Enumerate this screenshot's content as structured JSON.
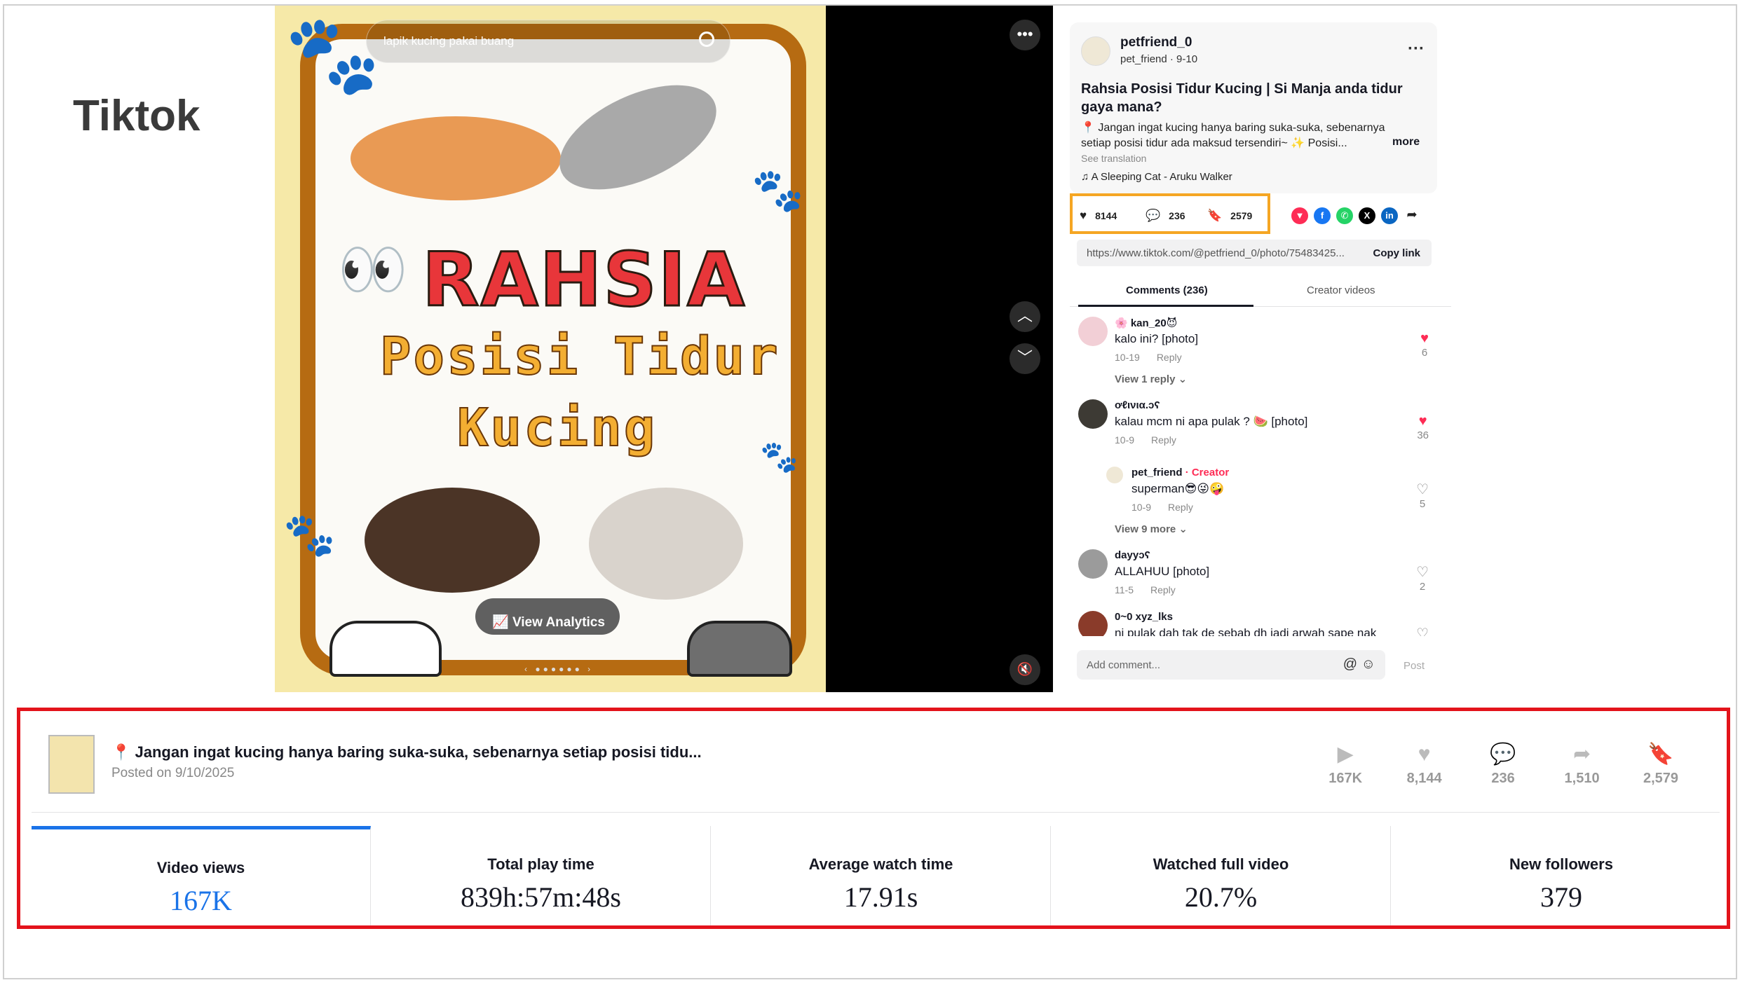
{
  "slide": {
    "title": "Tiktok"
  },
  "photo": {
    "search_text": "lapik kucing pakai buang",
    "overlay_title": "RAHSIA",
    "overlay_line2": "Posisi Tidur",
    "overlay_line3": "Kucing",
    "view_analytics": "View Analytics"
  },
  "post": {
    "author": "petfriend_0",
    "author_sub": "pet_friend · 9-10",
    "title": "Rahsia Posisi Tidur Kucing | Si Manja anda tidur gaya mana?",
    "description": "📍 Jangan ingat kucing hanya baring suka-suka, sebenarnya setiap posisi tidur ada maksud tersendiri~ ✨ Posisi...",
    "more": "more",
    "see_translation": "See translation",
    "music": "♫  A Sleeping Cat - Aruku Walker",
    "likes": "8144",
    "comments": "236",
    "saves": "2579",
    "link": "https://www.tiktok.com/@petfriend_0/photo/75483425...",
    "copy_link": "Copy link"
  },
  "tabs": [
    {
      "label": "Comments (236)"
    },
    {
      "label": "Creator videos"
    }
  ],
  "comments": [
    {
      "user": "🌸 kan_20😈",
      "text": "kalo ini? [photo]",
      "date": "10-19",
      "reply": "Reply",
      "likes": "6",
      "liked": true,
      "view_more": "View 1 reply ⌄"
    },
    {
      "user": "ơℓινια.ɔʕ",
      "text": "kalau mcm ni apa pulak ? 🍉 [photo]",
      "date": "10-9",
      "reply": "Reply",
      "likes": "36",
      "liked": true
    },
    {
      "user": "pet_friend",
      "creator": "· Creator",
      "text": "superman😎😜🤪",
      "date": "10-9",
      "reply": "Reply",
      "likes": "5",
      "liked": false,
      "view_more": "View 9 more ⌄"
    },
    {
      "user": "dayyɔʕ",
      "text": "ALLAHUU [photo]",
      "date": "11-5",
      "reply": "Reply",
      "likes": "2",
      "liked": false
    },
    {
      "user": "0~0 xyz_lks",
      "text": "ni pulak dah tak de sebab dh jadi arwah sape nak",
      "likes": "",
      "liked": false
    }
  ],
  "add_comment": {
    "placeholder": "Add comment...",
    "post": "Post"
  },
  "analytics": {
    "title": "📍 Jangan ingat kucing hanya baring suka-suka, sebenarnya setiap posisi tidu...",
    "posted": "Posted on 9/10/2025",
    "metrics": [
      {
        "icon": "▶",
        "value": "167K"
      },
      {
        "icon": "♥",
        "value": "8,144"
      },
      {
        "icon": "💬",
        "value": "236"
      },
      {
        "icon": "➦",
        "value": "1,510"
      },
      {
        "icon": "🔖",
        "value": "2,579"
      }
    ],
    "cards": [
      {
        "label": "Video views",
        "value": "167K"
      },
      {
        "label": "Total play time",
        "value": "839h:57m:48s"
      },
      {
        "label": "Average watch time",
        "value": "17.91s"
      },
      {
        "label": "Watched full video",
        "value": "20.7%"
      },
      {
        "label": "New followers",
        "value": "379"
      }
    ]
  },
  "colors": {
    "accent_blue": "#1a73e8",
    "highlight_orange": "#f5a623",
    "frame_red": "#e3131b",
    "tiktok_red": "#fe2c55"
  }
}
